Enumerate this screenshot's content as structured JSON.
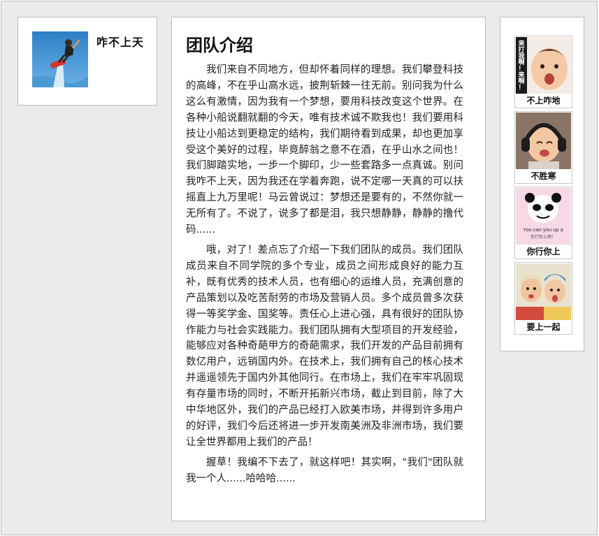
{
  "profile": {
    "name": "咋不上天",
    "avatar_icon": "flyboard-rider-avatar"
  },
  "intro": {
    "title": "团队介绍",
    "paragraphs": [
      "我们来自不同地方，但却怀着同样的理想。我们攀登科技的高峰，不在乎山高水远，披荆斩棘一往无前。别问我为什么这么有激情，因为我有一个梦想，要用科技改变这个世界。在各种小船说翻就翻的今天，唯有技术诚不欺我也！我们要用科技让小船达到更稳定的结构，我们期待看到成果，却也更加享受这个美好的过程，毕竟醉翁之意不在酒，在乎山水之间也！我们脚踏实地，一步一个脚印，少一些套路多一点真诚。别问我咋不上天，因为我还在学着奔跑，说不定哪一天真的可以扶摇直上九万里呢！马云曾说过：梦想还是要有的，不然你就一无所有了。不说了，说多了都是泪，我只想静静，静静的撸代码......",
      "哦，对了！差点忘了介绍一下我们团队的成员。我们团队成员来自不同学院的多个专业，成员之间形成良好的能力互补，既有优秀的技术人员，也有细心的运维人员，充满创意的产品策划以及吃苦耐劳的市场及营销人员。多个成员曾多次获得一等奖学金、国奖等。责任心上进心强，具有很好的团队协作能力与社会实践能力。我们团队拥有大型项目的开发经验，能够应对各种奇葩甲方的奇葩需求，我们开发的产品目前拥有数亿用户，远销国内外。在技术上，我们拥有自己的核心技术并遥遥领先于国内外其他同行。在市场上，我们在牢牢巩固现有存量市场的同时，不断开拓新兴市场，截止到目前，除了大中华地区外，我们的产品已经打入欧美市场，并得到许多用户的好评，我们今后还将进一步开发南美洲及非洲市场，我们要让全世界都用上我们的产品！",
      "握草！我编不下去了，就这样吧！其实啊，\"我们\"团队就我一个人......哈哈哈......"
    ]
  },
  "members": [
    {
      "label": "不上咋地",
      "image_text": "来打我啊！来啊！",
      "icon": "baby-meme-image"
    },
    {
      "label": "不胜寒",
      "image_text": "",
      "icon": "baby-headphones-image"
    },
    {
      "label": "你行你上",
      "image_text": "You can you up a",
      "image_subtext": "你行你上啊！",
      "icon": "panda-meme-image"
    },
    {
      "label": "要上一起",
      "image_text": "",
      "icon": "kids-duo-image"
    }
  ]
}
